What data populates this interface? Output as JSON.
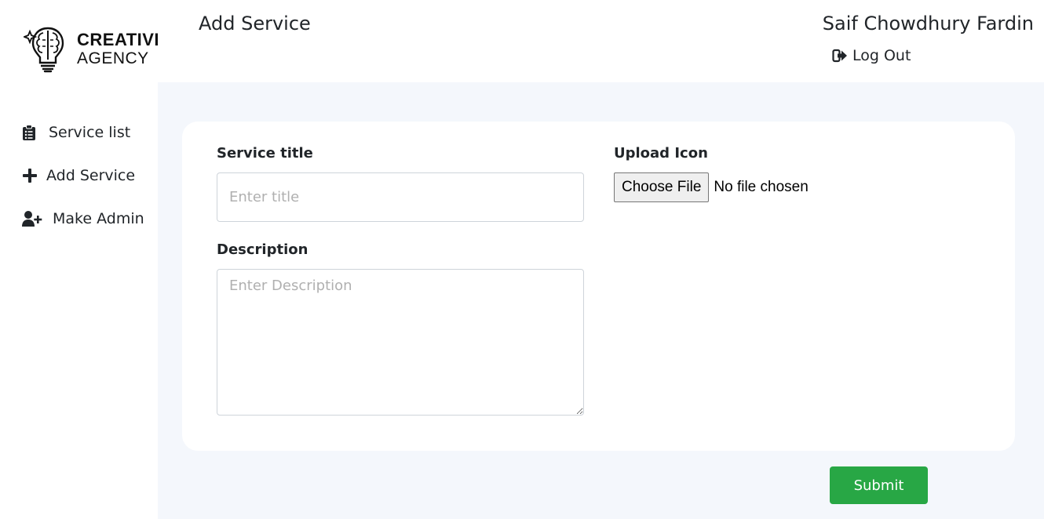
{
  "logo": {
    "line1": "CREATIVE",
    "line2": "AGENCY",
    "icon": "brain-bulb-icon"
  },
  "header": {
    "title": "Add Service",
    "user_name": "Saif Chowdhury Fardin",
    "logout_label": "Log Out",
    "logout_icon": "sign-out-icon"
  },
  "sidebar": {
    "items": [
      {
        "label": "Service list",
        "icon": "clipboard-list-icon"
      },
      {
        "label": "Add Service",
        "icon": "plus-icon"
      },
      {
        "label": "Make Admin",
        "icon": "user-plus-icon"
      }
    ]
  },
  "form": {
    "title_label": "Service title",
    "title_placeholder": "Enter title",
    "title_value": "",
    "description_label": "Description",
    "description_placeholder": "Enter Description",
    "description_value": "",
    "upload_label": "Upload Icon",
    "file_button_label": "Choose File",
    "file_status": "No file chosen",
    "submit_label": "Submit"
  },
  "colors": {
    "main_background": "#f4f7fc",
    "card_background": "#ffffff",
    "submit_background": "#28a745",
    "text": "#212529"
  }
}
